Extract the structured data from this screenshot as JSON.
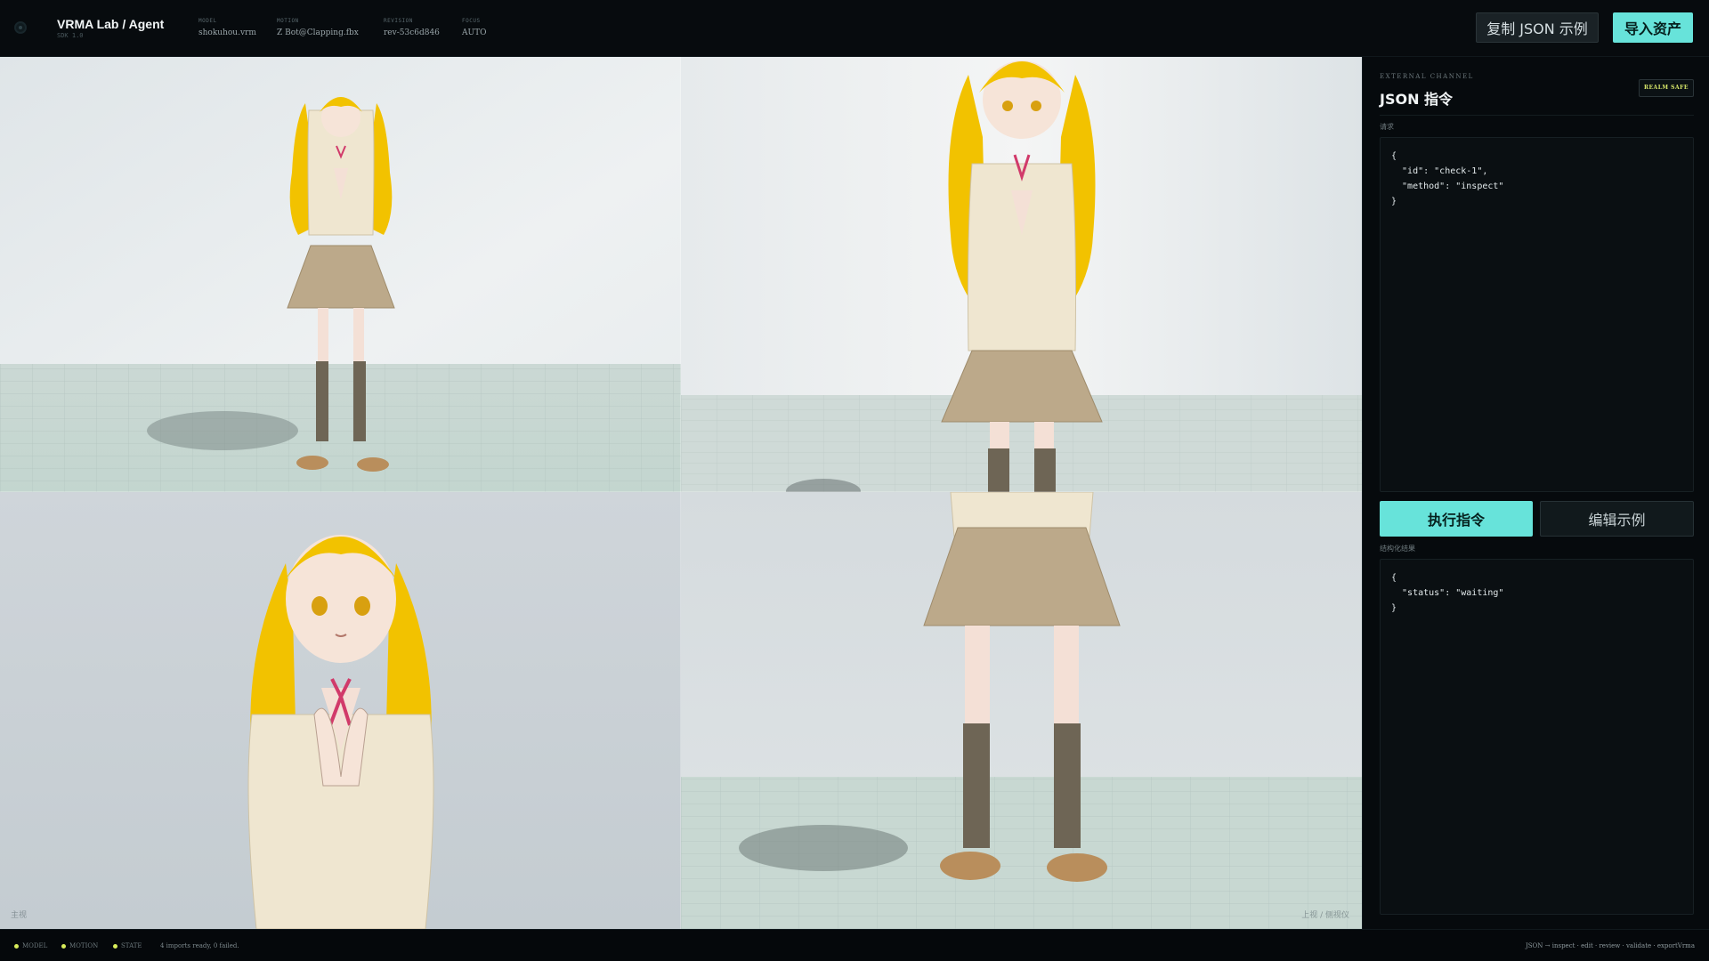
{
  "header": {
    "title": "VRMA Lab / Agent",
    "sdk": "SDK 1.0",
    "meta": [
      {
        "key": "MODEL",
        "value": "shokuhou.vrm"
      },
      {
        "key": "MOTION",
        "value": "Z Bot@Clapping.fbx"
      },
      {
        "key": "REVISION",
        "value": "rev-53c6d846"
      },
      {
        "key": "FOCUS",
        "value": "AUTO"
      }
    ],
    "copy_button": "复制 JSON 示例",
    "import_button": "导入资产"
  },
  "viewports": {
    "label_bl": "主视",
    "label_br": "上视 / 侧视仪"
  },
  "panel": {
    "channel_label": "EXTERNAL CHANNEL",
    "title": "JSON 指令",
    "badge": "REALM SAFE",
    "request_label": "请求",
    "request_code": "{\n  \"id\": \"check-1\",\n  \"method\": \"inspect\"\n}",
    "run_button": "执行指令",
    "edit_button": "编辑示例",
    "result_label": "结构化结果",
    "result_code": "{\n  \"status\": \"waiting\"\n}"
  },
  "status": {
    "items": [
      "MODEL",
      "MOTION",
      "STATE"
    ],
    "message": "4 imports ready, 0 failed.",
    "pipeline": "JSON → inspect · edit · review · validate · exportVrma",
    "dot_color": "#d8ec5a"
  },
  "colors": {
    "accent": "#67e3da",
    "background": "#05090c",
    "hair": "#f2c200"
  }
}
